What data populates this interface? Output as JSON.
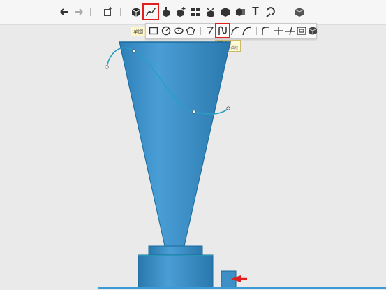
{
  "toolbar": {
    "icons": [
      "undo-icon",
      "redo-icon",
      "new-sketch-icon",
      "basic-shape-icon",
      "sketch-icon",
      "extrude-icon",
      "special-feature-icon",
      "pattern-icon",
      "modify-icon",
      "combine-icon",
      "transform-icon",
      "text-tool-icon",
      "measure-icon",
      "material-icon"
    ],
    "highlighted": "sketch-icon",
    "text_tool_glyph": "T"
  },
  "sketch_toolbar": {
    "tag_label": "草图",
    "tools": [
      "rectangle-tool-icon",
      "circle-tool-icon",
      "ellipse-tool-icon",
      "polygon-tool-icon",
      "line-tool-icon",
      "spline-tool-icon",
      "arc-tool-icon",
      "three-point-arc-tool-icon",
      "fillet-tool-icon",
      "trim-tool-icon",
      "extend-tool-icon",
      "offset-tool-icon",
      "project-tool-icon"
    ],
    "highlighted": "spline-tool-icon"
  },
  "tooltip": {
    "title": "样条曲线",
    "description": "创建样条曲线"
  },
  "colors": {
    "model_body": "#3d8fc6",
    "model_edge": "#1a6a9a",
    "model_dark": "#2a78ad",
    "spline": "#2a9fc0",
    "ground_line": "#3a9bd6",
    "arrow": "#e02020",
    "highlight": "#e02020"
  }
}
